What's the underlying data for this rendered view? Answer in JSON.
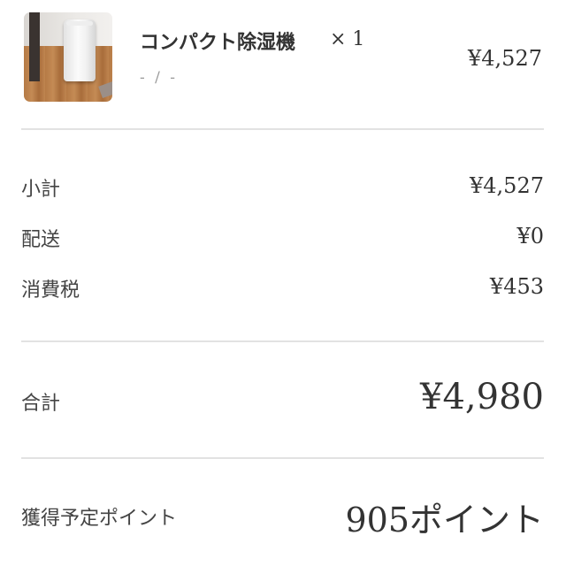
{
  "item": {
    "image_alt": "コンパクト除湿機",
    "name": "コンパクト除湿機",
    "quantity": "× 1",
    "variant": "- / -",
    "price": "¥4,527"
  },
  "summary": {
    "subtotal": {
      "label": "小計",
      "value": "¥4,527"
    },
    "shipping": {
      "label": "配送",
      "value": "¥0"
    },
    "tax": {
      "label": "消費税",
      "value": "¥453"
    }
  },
  "total": {
    "label": "合計",
    "value": "¥4,980"
  },
  "points": {
    "label": "獲得予定ポイント",
    "value": "905ポイント"
  },
  "colors": {
    "text": "#333333",
    "muted": "#9a9a9a",
    "divider": "#e2e2e2"
  }
}
